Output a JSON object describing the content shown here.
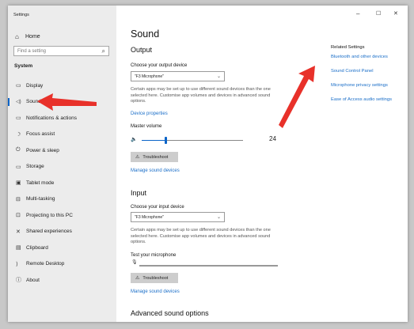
{
  "window": {
    "title": "Settings"
  },
  "window_controls": {
    "minimize": "–",
    "maximize": "☐",
    "close": "✕"
  },
  "sidebar": {
    "home": {
      "icon": "⌂",
      "label": "Home"
    },
    "search": {
      "placeholder": "Find a setting",
      "icon": "⌕"
    },
    "section": "System",
    "items": [
      {
        "icon": "▭",
        "label": "Display"
      },
      {
        "icon": "◁)",
        "label": "Sound",
        "selected": true
      },
      {
        "icon": "▭",
        "label": "Notifications & actions"
      },
      {
        "icon": "☽",
        "label": "Focus assist"
      },
      {
        "icon": "⏻",
        "label": "Power & sleep"
      },
      {
        "icon": "▭",
        "label": "Storage"
      },
      {
        "icon": "▣",
        "label": "Tablet mode"
      },
      {
        "icon": "⊟",
        "label": "Multi-tasking"
      },
      {
        "icon": "⊡",
        "label": "Projecting to this PC"
      },
      {
        "icon": "✕",
        "label": "Shared experiences"
      },
      {
        "icon": "▤",
        "label": "Clipboard"
      },
      {
        "icon": "⟩",
        "label": "Remote Desktop"
      },
      {
        "icon": "ⓘ",
        "label": "About"
      }
    ]
  },
  "main": {
    "title": "Sound",
    "output": {
      "heading": "Output",
      "device_label": "Choose your output device",
      "device_value": "\"F3 Microphone\"",
      "description": "Certain apps may be set up to use different sound devices than the one selected here. Customise app volumes and devices in advanced sound options.",
      "properties_link": "Device properties",
      "volume_label": "Master volume",
      "volume_icon": "🔈",
      "volume_value": "24",
      "volume_fraction": 0.24,
      "troubleshoot_icon": "⚠",
      "troubleshoot_label": "Troubleshoot",
      "manage_link": "Manage sound devices"
    },
    "input": {
      "heading": "Input",
      "device_label": "Choose your input device",
      "device_value": "\"F3 Microphone\"",
      "description": "Certain apps may be set up to use different sound devices than the one selected here. Customise app volumes and devices in advanced sound options.",
      "test_label": "Test your microphone",
      "mic_icon": "🎙",
      "troubleshoot_icon": "⚠",
      "troubleshoot_label": "Troubleshoot",
      "manage_link": "Manage sound devices"
    },
    "advanced_heading": "Advanced sound options"
  },
  "related": {
    "title": "Related Settings",
    "links": [
      "Bluetooth and other devices",
      "Sound Control Panel",
      "Microphone privacy settings",
      "Ease of Access audio settings"
    ]
  },
  "colors": {
    "accent": "#0a64c8",
    "annotation_arrow": "#e8312a"
  }
}
